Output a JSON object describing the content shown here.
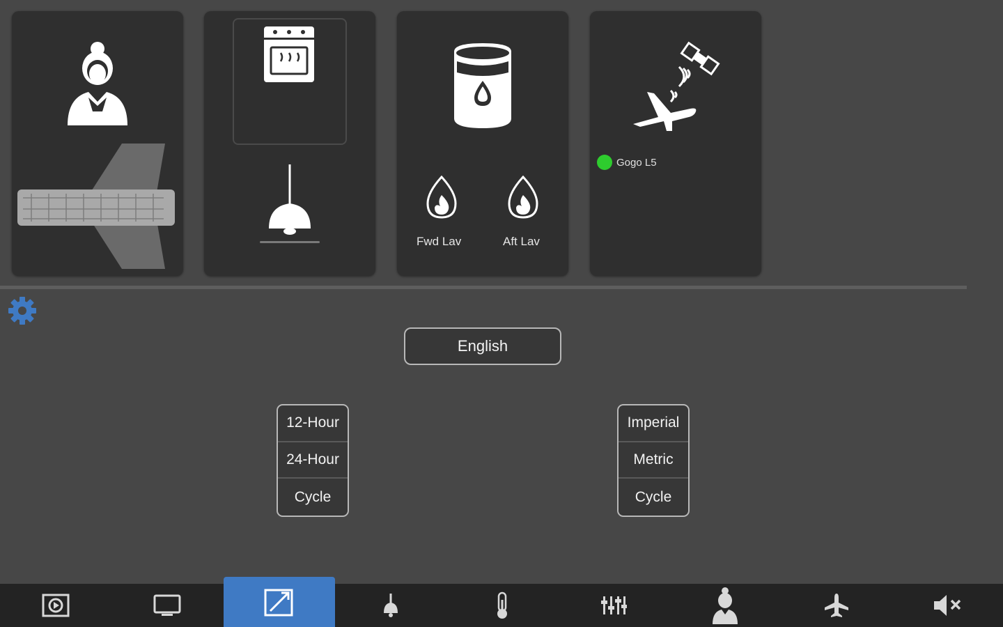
{
  "tiles": {
    "crew": {
      "icon": "flight-attendant-icon",
      "map_icon": "aircraft-cabin-map-icon"
    },
    "galley": {
      "oven_icon": "oven-icon",
      "lamp_icon": "pendant-lamp-icon"
    },
    "water": {
      "tank_icon": "water-tank-icon",
      "flame_icon": "waste-flame-icon",
      "fwd_label": "Fwd Lav",
      "aft_label": "Aft Lav"
    },
    "connectivity": {
      "icon": "satellite-airplane-icon",
      "status_label": "Gogo L5",
      "status_color": "#2ecc2e"
    }
  },
  "settings": {
    "gear_icon": "gear-icon",
    "gear_color": "#3f7ac4",
    "language_label": "English",
    "time_format": [
      "12-Hour",
      "24-Hour",
      "Cycle"
    ],
    "units": [
      "Imperial",
      "Metric",
      "Cycle"
    ]
  },
  "nav": {
    "active_color": "#3f7ac4",
    "items": [
      {
        "icon": "video-icon"
      },
      {
        "icon": "monitor-icon"
      },
      {
        "icon": "window-shade-icon",
        "active": true
      },
      {
        "icon": "lamp-icon"
      },
      {
        "icon": "thermometer-icon"
      },
      {
        "icon": "mixer-sliders-icon"
      },
      {
        "icon": "attendant-icon"
      },
      {
        "icon": "airplane-icon"
      },
      {
        "icon": "mute-icon"
      }
    ]
  }
}
